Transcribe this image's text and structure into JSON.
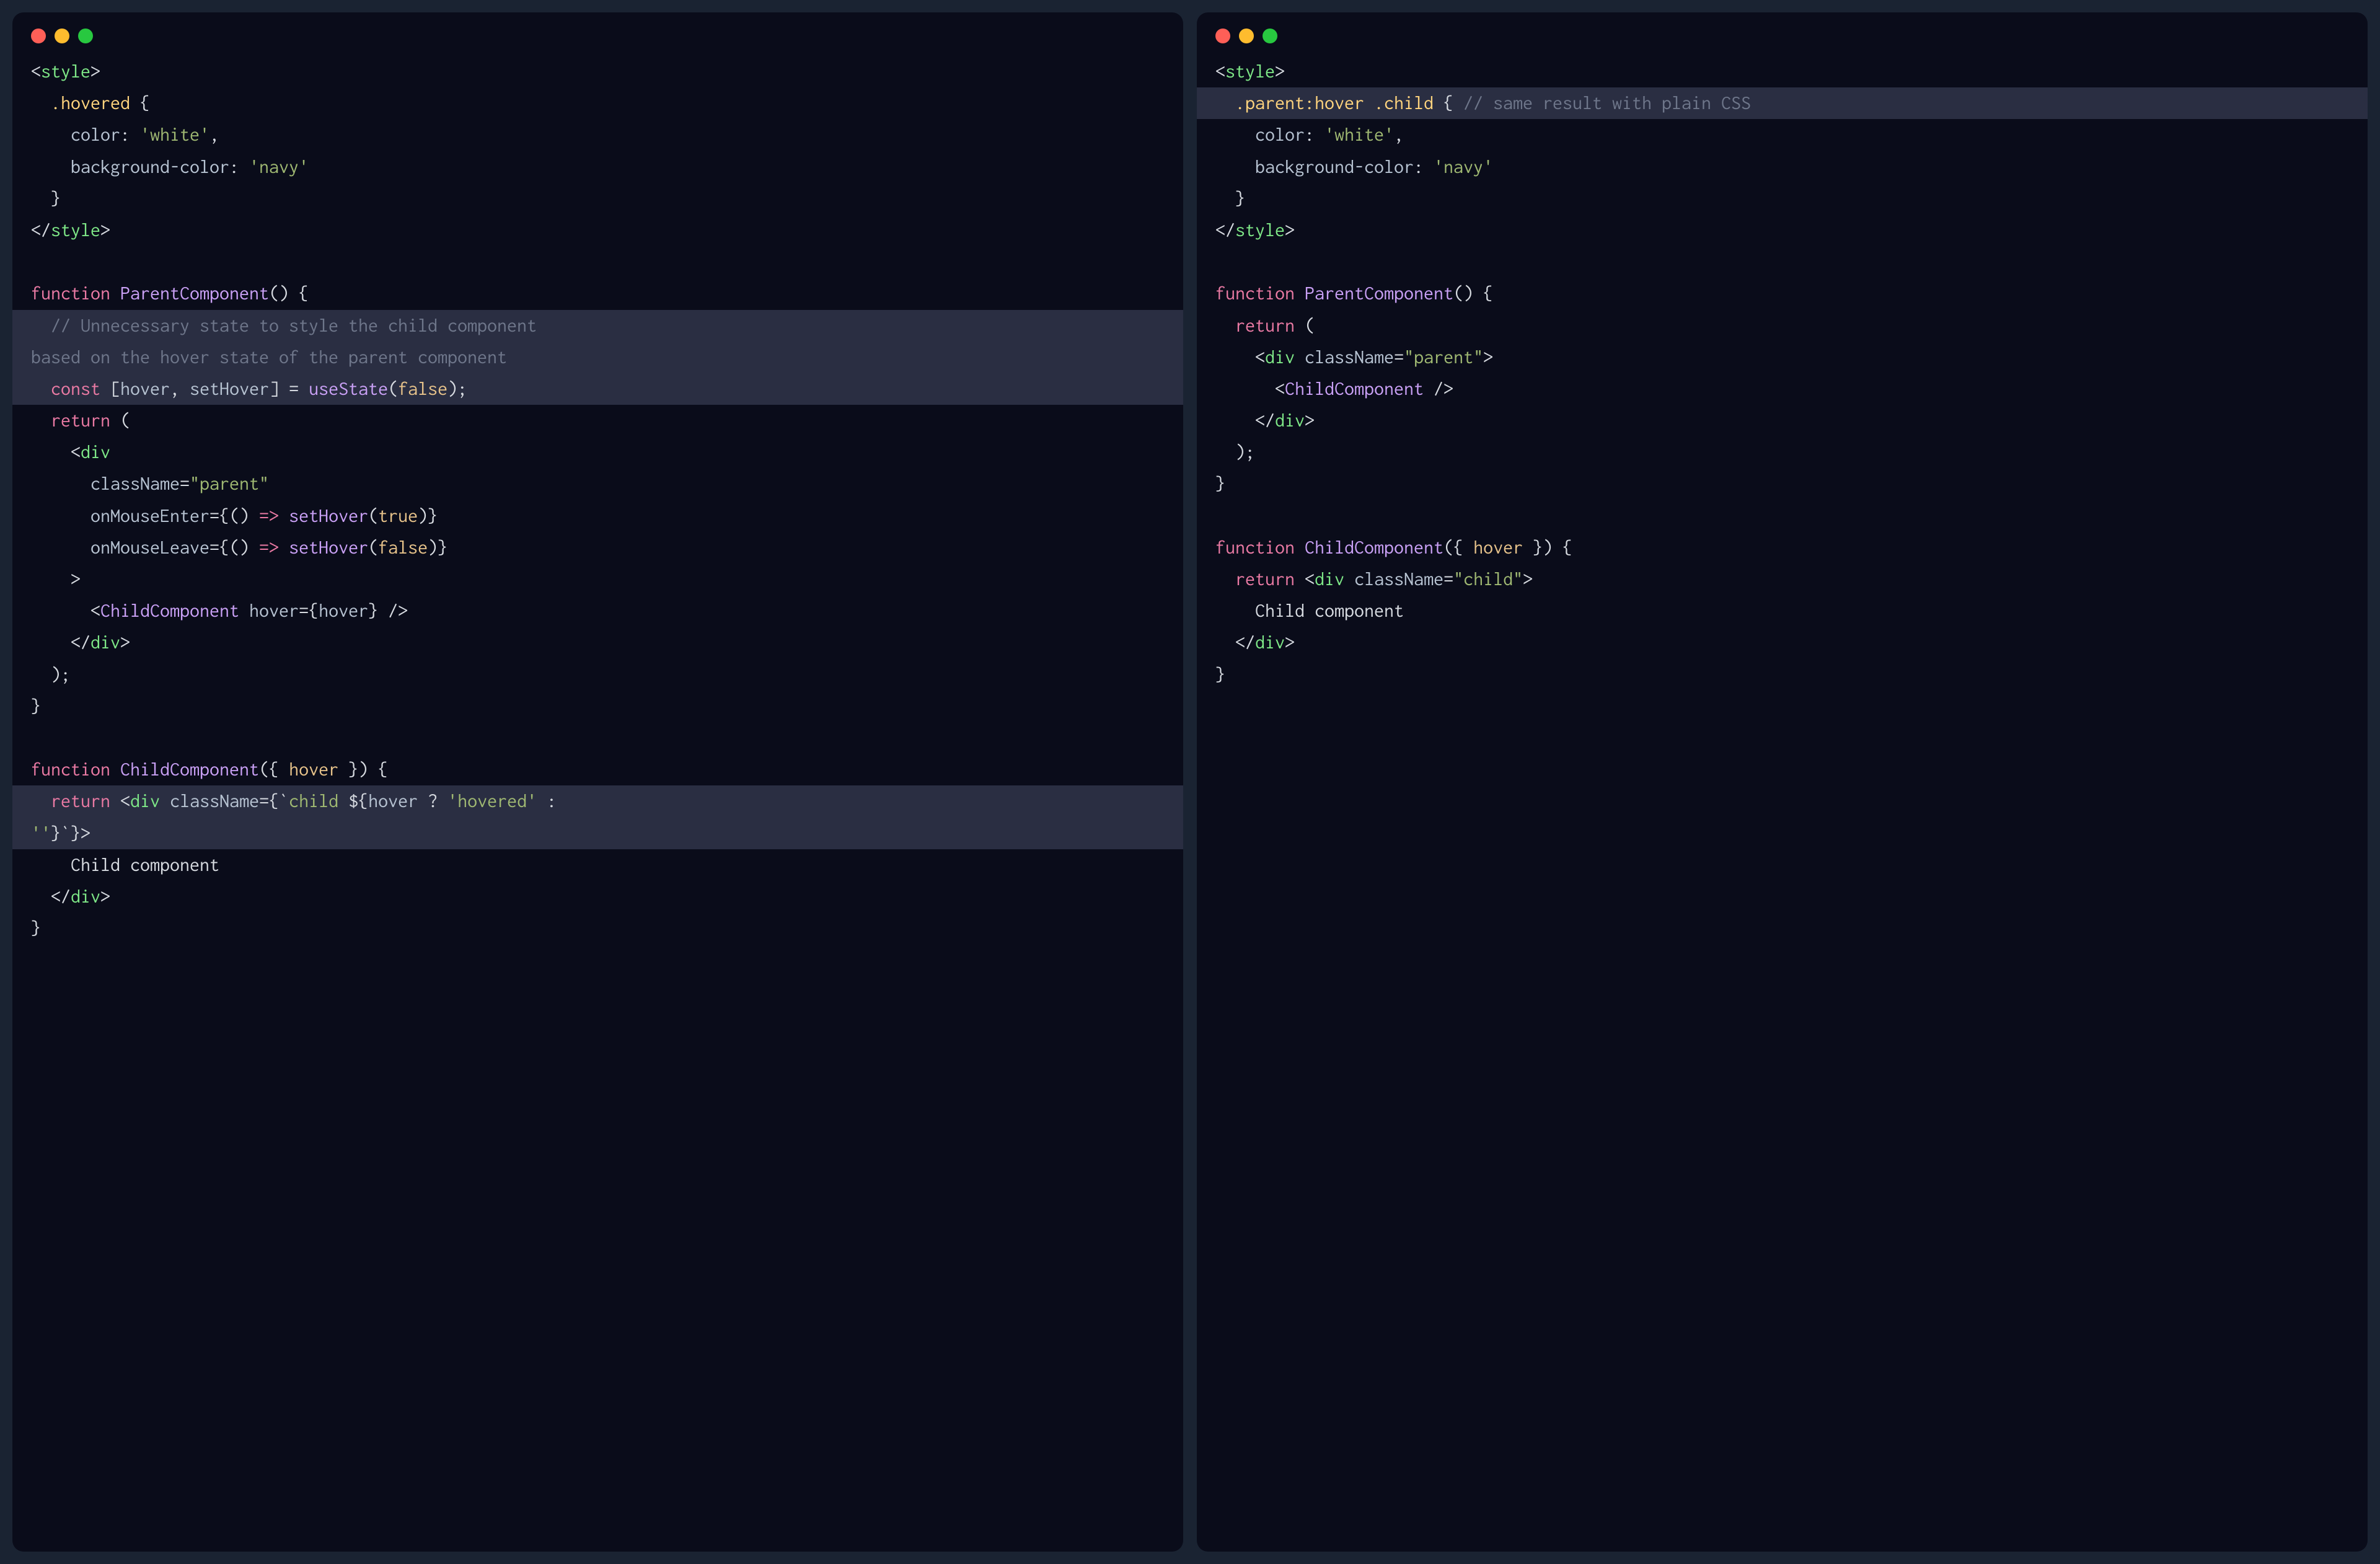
{
  "left": {
    "lines": [
      {
        "hl": false,
        "tokens": [
          {
            "c": "t-punct",
            "t": "<"
          },
          {
            "c": "t-tagname",
            "t": "style"
          },
          {
            "c": "t-punct",
            "t": ">"
          }
        ]
      },
      {
        "hl": false,
        "tokens": [
          {
            "c": "t-punct",
            "t": "  "
          },
          {
            "c": "t-css-sel",
            "t": ".hovered"
          },
          {
            "c": "t-punct",
            "t": " {"
          }
        ]
      },
      {
        "hl": false,
        "tokens": [
          {
            "c": "t-punct",
            "t": "    "
          },
          {
            "c": "t-css-prop",
            "t": "color"
          },
          {
            "c": "t-punct",
            "t": ": "
          },
          {
            "c": "t-str",
            "t": "'white'"
          },
          {
            "c": "t-punct",
            "t": ","
          }
        ]
      },
      {
        "hl": false,
        "tokens": [
          {
            "c": "t-punct",
            "t": "    "
          },
          {
            "c": "t-css-prop",
            "t": "background-color"
          },
          {
            "c": "t-punct",
            "t": ": "
          },
          {
            "c": "t-str",
            "t": "'navy'"
          }
        ]
      },
      {
        "hl": false,
        "tokens": [
          {
            "c": "t-punct",
            "t": "  }"
          }
        ]
      },
      {
        "hl": false,
        "tokens": [
          {
            "c": "t-punct",
            "t": "</"
          },
          {
            "c": "t-tagname",
            "t": "style"
          },
          {
            "c": "t-punct",
            "t": ">"
          }
        ]
      },
      {
        "hl": false,
        "tokens": []
      },
      {
        "hl": false,
        "tokens": [
          {
            "c": "t-kw",
            "t": "function"
          },
          {
            "c": "t-punct",
            "t": " "
          },
          {
            "c": "t-fn",
            "t": "ParentComponent"
          },
          {
            "c": "t-punct",
            "t": "() {"
          }
        ]
      },
      {
        "hl": true,
        "tokens": [
          {
            "c": "t-punct",
            "t": "  "
          },
          {
            "c": "t-comment",
            "t": "// Unnecessary state to style the child component "
          }
        ]
      },
      {
        "hl": true,
        "tokens": [
          {
            "c": "t-comment",
            "t": "based on the hover state of the parent component"
          }
        ]
      },
      {
        "hl": true,
        "tokens": [
          {
            "c": "t-punct",
            "t": "  "
          },
          {
            "c": "t-kw",
            "t": "const"
          },
          {
            "c": "t-punct",
            "t": " ["
          },
          {
            "c": "t-attr",
            "t": "hover"
          },
          {
            "c": "t-punct",
            "t": ", "
          },
          {
            "c": "t-attr",
            "t": "setHover"
          },
          {
            "c": "t-punct",
            "t": "] = "
          },
          {
            "c": "t-fn",
            "t": "useState"
          },
          {
            "c": "t-punct",
            "t": "("
          },
          {
            "c": "t-bool",
            "t": "false"
          },
          {
            "c": "t-punct",
            "t": ");"
          }
        ]
      },
      {
        "hl": false,
        "tokens": [
          {
            "c": "t-punct",
            "t": "  "
          },
          {
            "c": "t-kw",
            "t": "return"
          },
          {
            "c": "t-punct",
            "t": " ("
          }
        ]
      },
      {
        "hl": false,
        "tokens": [
          {
            "c": "t-punct",
            "t": "    <"
          },
          {
            "c": "t-tagname",
            "t": "div"
          }
        ]
      },
      {
        "hl": false,
        "tokens": [
          {
            "c": "t-punct",
            "t": "      "
          },
          {
            "c": "t-attr",
            "t": "className"
          },
          {
            "c": "t-punct",
            "t": "="
          },
          {
            "c": "t-str",
            "t": "\"parent\""
          }
        ]
      },
      {
        "hl": false,
        "tokens": [
          {
            "c": "t-punct",
            "t": "      "
          },
          {
            "c": "t-attr",
            "t": "onMouseEnter"
          },
          {
            "c": "t-punct",
            "t": "={() "
          },
          {
            "c": "t-arrow",
            "t": "=>"
          },
          {
            "c": "t-punct",
            "t": " "
          },
          {
            "c": "t-fn",
            "t": "setHover"
          },
          {
            "c": "t-punct",
            "t": "("
          },
          {
            "c": "t-bool",
            "t": "true"
          },
          {
            "c": "t-punct",
            "t": ")}"
          }
        ]
      },
      {
        "hl": false,
        "tokens": [
          {
            "c": "t-punct",
            "t": "      "
          },
          {
            "c": "t-attr",
            "t": "onMouseLeave"
          },
          {
            "c": "t-punct",
            "t": "={() "
          },
          {
            "c": "t-arrow",
            "t": "=>"
          },
          {
            "c": "t-punct",
            "t": " "
          },
          {
            "c": "t-fn",
            "t": "setHover"
          },
          {
            "c": "t-punct",
            "t": "("
          },
          {
            "c": "t-bool",
            "t": "false"
          },
          {
            "c": "t-punct",
            "t": ")}"
          }
        ]
      },
      {
        "hl": false,
        "tokens": [
          {
            "c": "t-punct",
            "t": "    >"
          }
        ]
      },
      {
        "hl": false,
        "tokens": [
          {
            "c": "t-punct",
            "t": "      <"
          },
          {
            "c": "t-comp",
            "t": "ChildComponent"
          },
          {
            "c": "t-punct",
            "t": " "
          },
          {
            "c": "t-attr",
            "t": "hover"
          },
          {
            "c": "t-punct",
            "t": "={"
          },
          {
            "c": "t-attr",
            "t": "hover"
          },
          {
            "c": "t-punct",
            "t": "} />"
          }
        ]
      },
      {
        "hl": false,
        "tokens": [
          {
            "c": "t-punct",
            "t": "    </"
          },
          {
            "c": "t-tagname",
            "t": "div"
          },
          {
            "c": "t-punct",
            "t": ">"
          }
        ]
      },
      {
        "hl": false,
        "tokens": [
          {
            "c": "t-punct",
            "t": "  );"
          }
        ]
      },
      {
        "hl": false,
        "tokens": [
          {
            "c": "t-punct",
            "t": "}"
          }
        ]
      },
      {
        "hl": false,
        "tokens": []
      },
      {
        "hl": false,
        "tokens": [
          {
            "c": "t-kw",
            "t": "function"
          },
          {
            "c": "t-punct",
            "t": " "
          },
          {
            "c": "t-fn",
            "t": "ChildComponent"
          },
          {
            "c": "t-punct",
            "t": "({ "
          },
          {
            "c": "t-param",
            "t": "hover"
          },
          {
            "c": "t-punct",
            "t": " }) {"
          }
        ]
      },
      {
        "hl": true,
        "tokens": [
          {
            "c": "t-punct",
            "t": "  "
          },
          {
            "c": "t-kw",
            "t": "return"
          },
          {
            "c": "t-punct",
            "t": " <"
          },
          {
            "c": "t-tagname",
            "t": "div"
          },
          {
            "c": "t-punct",
            "t": " "
          },
          {
            "c": "t-attr",
            "t": "className"
          },
          {
            "c": "t-punct",
            "t": "={`"
          },
          {
            "c": "t-str",
            "t": "child "
          },
          {
            "c": "t-punct",
            "t": "${"
          },
          {
            "c": "t-attr",
            "t": "hover"
          },
          {
            "c": "t-punct",
            "t": " ? "
          },
          {
            "c": "t-str",
            "t": "'hovered'"
          },
          {
            "c": "t-punct",
            "t": " : "
          }
        ]
      },
      {
        "hl": true,
        "tokens": [
          {
            "c": "t-str",
            "t": "''"
          },
          {
            "c": "t-punct",
            "t": "}`}>"
          }
        ]
      },
      {
        "hl": false,
        "tokens": [
          {
            "c": "t-punct",
            "t": "    Child component"
          }
        ]
      },
      {
        "hl": false,
        "tokens": [
          {
            "c": "t-punct",
            "t": "  </"
          },
          {
            "c": "t-tagname",
            "t": "div"
          },
          {
            "c": "t-punct",
            "t": ">"
          }
        ]
      },
      {
        "hl": false,
        "tokens": [
          {
            "c": "t-punct",
            "t": "}"
          }
        ]
      }
    ]
  },
  "right": {
    "lines": [
      {
        "hl": false,
        "tokens": [
          {
            "c": "t-punct",
            "t": "<"
          },
          {
            "c": "t-tagname",
            "t": "style"
          },
          {
            "c": "t-punct",
            "t": ">"
          }
        ]
      },
      {
        "hl": true,
        "tokens": [
          {
            "c": "t-punct",
            "t": "  "
          },
          {
            "c": "t-css-sel",
            "t": ".parent:hover .child"
          },
          {
            "c": "t-punct",
            "t": " { "
          },
          {
            "c": "t-comment",
            "t": "// same result with plain CSS"
          }
        ]
      },
      {
        "hl": false,
        "tokens": [
          {
            "c": "t-punct",
            "t": "    "
          },
          {
            "c": "t-css-prop",
            "t": "color"
          },
          {
            "c": "t-punct",
            "t": ": "
          },
          {
            "c": "t-str",
            "t": "'white'"
          },
          {
            "c": "t-punct",
            "t": ","
          }
        ]
      },
      {
        "hl": false,
        "tokens": [
          {
            "c": "t-punct",
            "t": "    "
          },
          {
            "c": "t-css-prop",
            "t": "background-color"
          },
          {
            "c": "t-punct",
            "t": ": "
          },
          {
            "c": "t-str",
            "t": "'navy'"
          }
        ]
      },
      {
        "hl": false,
        "tokens": [
          {
            "c": "t-punct",
            "t": "  }"
          }
        ]
      },
      {
        "hl": false,
        "tokens": [
          {
            "c": "t-punct",
            "t": "</"
          },
          {
            "c": "t-tagname",
            "t": "style"
          },
          {
            "c": "t-punct",
            "t": ">"
          }
        ]
      },
      {
        "hl": false,
        "tokens": []
      },
      {
        "hl": false,
        "tokens": [
          {
            "c": "t-kw",
            "t": "function"
          },
          {
            "c": "t-punct",
            "t": " "
          },
          {
            "c": "t-fn",
            "t": "ParentComponent"
          },
          {
            "c": "t-punct",
            "t": "() {"
          }
        ]
      },
      {
        "hl": false,
        "tokens": [
          {
            "c": "t-punct",
            "t": "  "
          },
          {
            "c": "t-kw",
            "t": "return"
          },
          {
            "c": "t-punct",
            "t": " ("
          }
        ]
      },
      {
        "hl": false,
        "tokens": [
          {
            "c": "t-punct",
            "t": "    <"
          },
          {
            "c": "t-tagname",
            "t": "div"
          },
          {
            "c": "t-punct",
            "t": " "
          },
          {
            "c": "t-attr",
            "t": "className"
          },
          {
            "c": "t-punct",
            "t": "="
          },
          {
            "c": "t-str",
            "t": "\"parent\""
          },
          {
            "c": "t-punct",
            "t": ">"
          }
        ]
      },
      {
        "hl": false,
        "tokens": [
          {
            "c": "t-punct",
            "t": "      <"
          },
          {
            "c": "t-comp",
            "t": "ChildComponent"
          },
          {
            "c": "t-punct",
            "t": " />"
          }
        ]
      },
      {
        "hl": false,
        "tokens": [
          {
            "c": "t-punct",
            "t": "    </"
          },
          {
            "c": "t-tagname",
            "t": "div"
          },
          {
            "c": "t-punct",
            "t": ">"
          }
        ]
      },
      {
        "hl": false,
        "tokens": [
          {
            "c": "t-punct",
            "t": "  );"
          }
        ]
      },
      {
        "hl": false,
        "tokens": [
          {
            "c": "t-punct",
            "t": "}"
          }
        ]
      },
      {
        "hl": false,
        "tokens": []
      },
      {
        "hl": false,
        "tokens": [
          {
            "c": "t-kw",
            "t": "function"
          },
          {
            "c": "t-punct",
            "t": " "
          },
          {
            "c": "t-fn",
            "t": "ChildComponent"
          },
          {
            "c": "t-punct",
            "t": "({ "
          },
          {
            "c": "t-param",
            "t": "hover"
          },
          {
            "c": "t-punct",
            "t": " }) {"
          }
        ]
      },
      {
        "hl": false,
        "tokens": [
          {
            "c": "t-punct",
            "t": "  "
          },
          {
            "c": "t-kw",
            "t": "return"
          },
          {
            "c": "t-punct",
            "t": " <"
          },
          {
            "c": "t-tagname",
            "t": "div"
          },
          {
            "c": "t-punct",
            "t": " "
          },
          {
            "c": "t-attr",
            "t": "className"
          },
          {
            "c": "t-punct",
            "t": "="
          },
          {
            "c": "t-str",
            "t": "\"child\""
          },
          {
            "c": "t-punct",
            "t": ">"
          }
        ]
      },
      {
        "hl": false,
        "tokens": [
          {
            "c": "t-punct",
            "t": "    Child component"
          }
        ]
      },
      {
        "hl": false,
        "tokens": [
          {
            "c": "t-punct",
            "t": "  </"
          },
          {
            "c": "t-tagname",
            "t": "div"
          },
          {
            "c": "t-punct",
            "t": ">"
          }
        ]
      },
      {
        "hl": false,
        "tokens": [
          {
            "c": "t-punct",
            "t": "}"
          }
        ]
      }
    ]
  }
}
